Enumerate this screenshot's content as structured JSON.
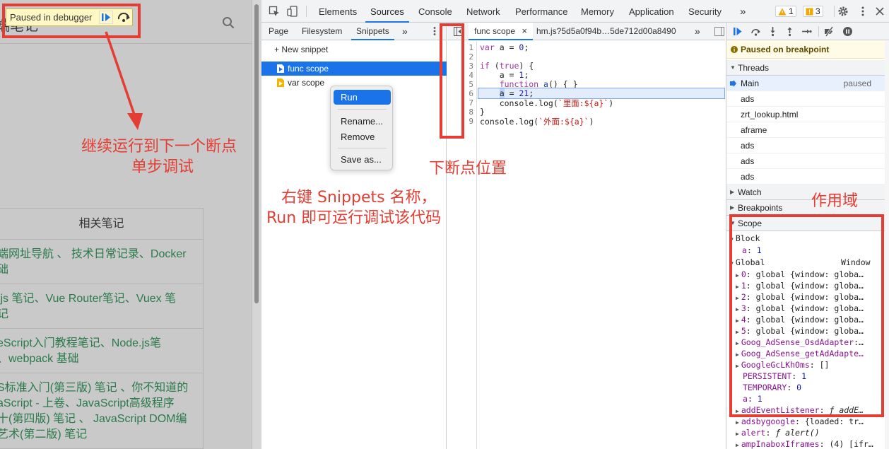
{
  "page": {
    "site_title": "端笔记",
    "notes_header": "相关笔记",
    "notes_rows": [
      [
        "端网址导航 、 技术日常记录、Docker",
        "础"
      ],
      [
        ".js 笔记、Vue Router笔记、Vuex 笔",
        "记"
      ],
      [
        "eScript入门教程笔记、Node.js笔",
        "、webpack 基础"
      ],
      [
        "S标准入门(第三版) 笔记 、你不知道的",
        "aScript - 上卷、JavaScript高级程序",
        "十(第四版) 笔记 、 JavaScript DOM编",
        "艺术(第二版) 笔记"
      ]
    ],
    "paused_label": "Paused in debugger"
  },
  "devtools": {
    "tabs": [
      "Elements",
      "Sources",
      "Console",
      "Network",
      "Performance",
      "Memory",
      "Application",
      "Security"
    ],
    "active_tab": "Sources",
    "more": "»",
    "warnings": "1",
    "errors": "3",
    "navigator_tabs": [
      "Page",
      "Filesystem",
      "Snippets"
    ],
    "active_navigator_tab": "Snippets",
    "new_snippet": "+ New snippet",
    "snippets": [
      "func scope",
      "var scope"
    ],
    "context_menu": [
      "Run",
      "Rename...",
      "Remove",
      "Save as..."
    ],
    "editor_tabs": [
      "func scope",
      "hm.js?5d5a0f94b…5de712d00a8490"
    ],
    "close_glyph": "×",
    "line_numbers": [
      "1",
      "2",
      "3",
      "4",
      "5",
      "6",
      "7",
      "8",
      "9"
    ],
    "paused_on_breakpoint": "Paused on breakpoint",
    "sections": {
      "threads": "Threads",
      "watch": "Watch",
      "breakpoints": "Breakpoints",
      "scope": "Scope"
    },
    "threads": [
      {
        "name": "Main",
        "status": "paused"
      },
      {
        "name": "ads",
        "status": ""
      },
      {
        "name": "zrt_lookup.html",
        "status": ""
      },
      {
        "name": "aframe",
        "status": ""
      },
      {
        "name": "ads",
        "status": ""
      },
      {
        "name": "ads",
        "status": ""
      },
      {
        "name": "ads",
        "status": ""
      }
    ],
    "scope_block": "Block",
    "scope_block_var": "a",
    "scope_block_val": "1",
    "scope_global": "Global",
    "scope_global_val": "Window",
    "scope_globals": [
      {
        "k": "0",
        "v": "global {window: globa…"
      },
      {
        "k": "1",
        "v": "global {window: globa…"
      },
      {
        "k": "2",
        "v": "global {window: globa…"
      },
      {
        "k": "3",
        "v": "global {window: globa…"
      },
      {
        "k": "4",
        "v": "global {window: globa…"
      },
      {
        "k": "5",
        "v": "global {window: globa…"
      },
      {
        "k": "Goog_AdSense_OsdAdapter",
        "v": "…"
      },
      {
        "k": "Goog_AdSense_getAdAdapte…",
        "v": ""
      },
      {
        "k": "GoogleGcLKhOms",
        "v": "[]"
      }
    ],
    "scope_props": [
      {
        "k": "PERSISTENT",
        "v": "1"
      },
      {
        "k": "TEMPORARY",
        "v": "0"
      },
      {
        "k": "a",
        "v": "1"
      }
    ],
    "scope_more": [
      {
        "k": "addEventListener",
        "v": "ƒ addE…"
      },
      {
        "k": "adsbygoogle",
        "v": "{loaded: tr…"
      },
      {
        "k": "alert",
        "v": "ƒ alert()"
      },
      {
        "k": "ampInaboxIframes",
        "v": "(4) [ifr…"
      }
    ]
  },
  "annotations": {
    "continue_1": "继续运行到下一个断点",
    "continue_2": "单步调试",
    "breakpoint_pos": "下断点位置",
    "snippets_1": "右键 Snippets 名称，",
    "snippets_2": "Run 即可运行调试该代码",
    "scope": "作用域"
  },
  "colors": {
    "annotation": "#e43d33",
    "accent": "#1a73e8"
  }
}
